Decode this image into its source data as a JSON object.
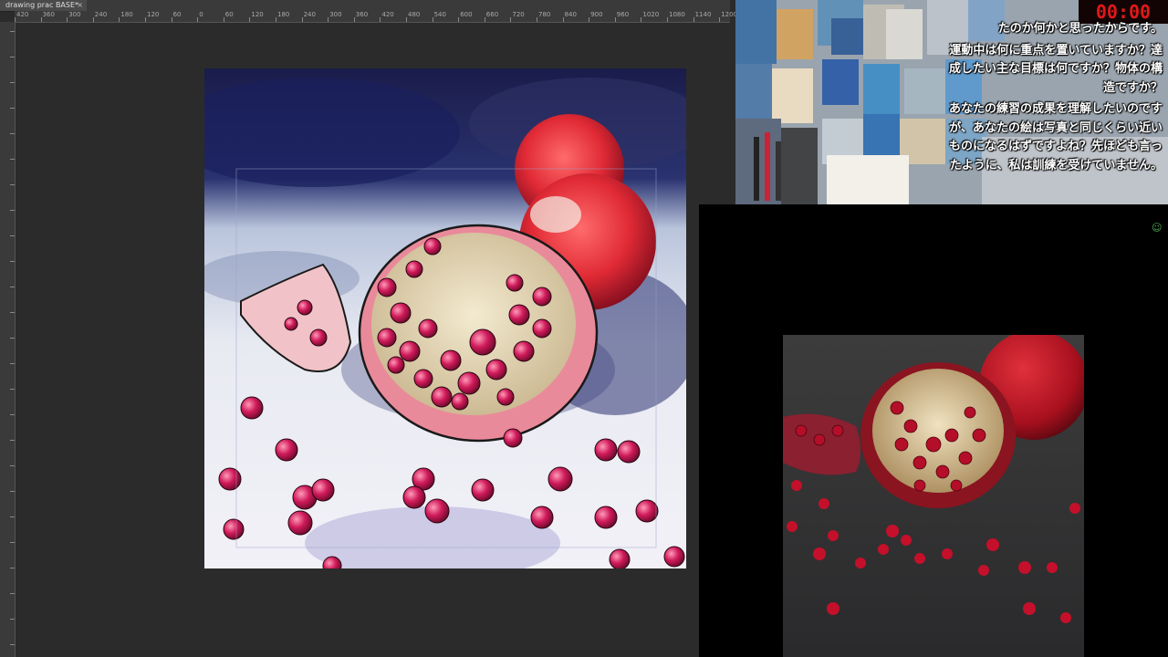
{
  "document_tab": {
    "title": "drawing prac BASE*",
    "close_glyph": "×"
  },
  "ruler_top_labels": [
    "420",
    "360",
    "300",
    "240",
    "180",
    "120",
    "60",
    "0",
    "60",
    "120",
    "180",
    "240",
    "300",
    "360",
    "420",
    "480",
    "540",
    "600",
    "660",
    "720",
    "780",
    "840",
    "900",
    "960",
    "1020",
    "1080",
    "1140",
    "1200"
  ],
  "webcam": {
    "timer": "00:00",
    "subtitles": [
      "たのか何かと思ったからです。",
      "運動中は何に重点を置いていますか？達成したい主な目標は何ですか？物体の構造ですか？",
      "あなたの練習の成果を理解したいのですが、あなたの絵は写真と同じくらい近いものになるはずですよね？先ほども言ったように、私は訓練を受けていません。"
    ]
  },
  "colors": {
    "app_bg": "#2b2b2b",
    "timer_text": "#e01818",
    "pomegranate_red": "#c8102e"
  },
  "icons": {
    "close": "close-icon",
    "status": "smiley-icon"
  }
}
